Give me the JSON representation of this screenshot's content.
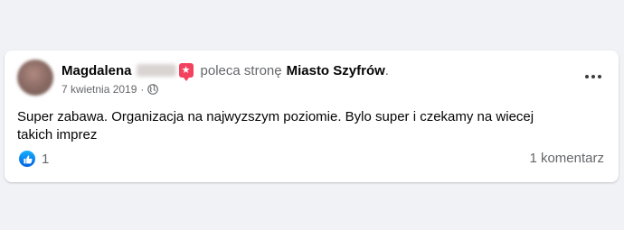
{
  "post": {
    "author_name": "Magdalena",
    "action_text": "poleca stronę",
    "page_name": "Miasto Szyfrów",
    "period": ".",
    "date": "7 kwietnia 2019",
    "separator": "·",
    "privacy_icon": "globe-icon",
    "badge_icon": "recommend-star-icon",
    "body": "Super zabawa. Organizacja na najwyzszym poziomie. Bylo super i czekamy na wiecej takich imprez",
    "reactions": {
      "icon": "like-icon",
      "count": "1"
    },
    "comments_label": "1 komentarz",
    "more_icon": "more-options-icon"
  },
  "colors": {
    "background": "#f0f2f5",
    "card": "#ffffff",
    "secondary_text": "#65676b",
    "primary_text": "#050505",
    "badge": "#f3425f",
    "like_blue": "#0866ff"
  }
}
